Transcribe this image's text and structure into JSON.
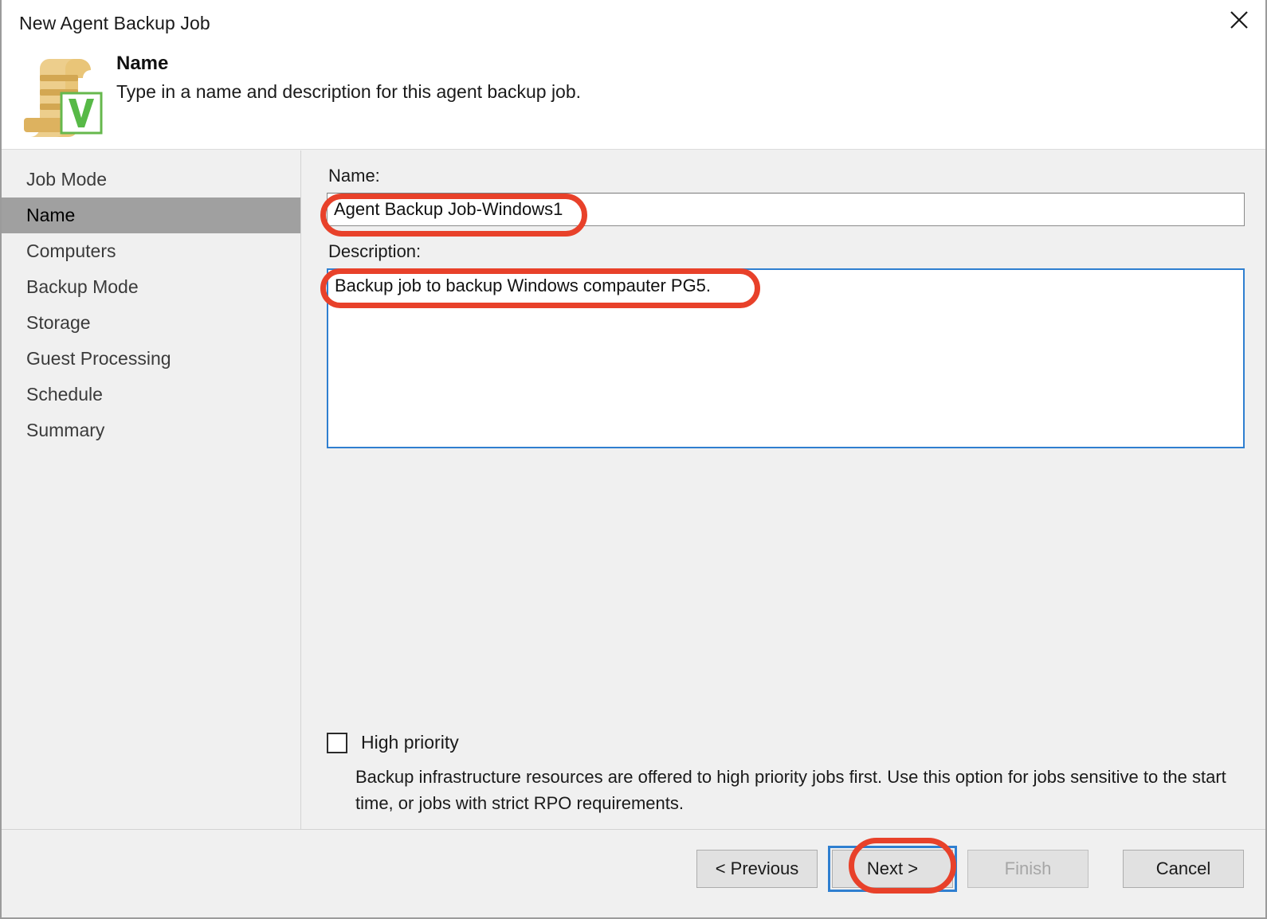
{
  "window": {
    "title": "New Agent Backup Job",
    "close_icon": "close-icon"
  },
  "header": {
    "icon": "document-scroll-veeam-icon",
    "title": "Name",
    "subtitle": "Type in a name and description for this agent backup job."
  },
  "sidebar": {
    "items": [
      {
        "label": "Job Mode",
        "selected": false
      },
      {
        "label": "Name",
        "selected": true
      },
      {
        "label": "Computers",
        "selected": false
      },
      {
        "label": "Backup Mode",
        "selected": false
      },
      {
        "label": "Storage",
        "selected": false
      },
      {
        "label": "Guest Processing",
        "selected": false
      },
      {
        "label": "Schedule",
        "selected": false
      },
      {
        "label": "Summary",
        "selected": false
      }
    ]
  },
  "form": {
    "name_label": "Name:",
    "name_value": "Agent Backup Job-Windows1",
    "name_placeholder": "",
    "description_label": "Description:",
    "description_value": "Backup job to backup Windows compauter PG5.",
    "description_placeholder": "",
    "high_priority_label": "High priority",
    "high_priority_checked": false,
    "high_priority_description": "Backup infrastructure resources are offered to high priority jobs first. Use this option for jobs sensitive to the start time, or jobs with strict RPO requirements."
  },
  "footer": {
    "previous_label": "< Previous",
    "next_label": "Next >",
    "finish_label": "Finish",
    "cancel_label": "Cancel",
    "finish_disabled": true,
    "next_focused": true
  },
  "annotations": {
    "color": "#e8412a",
    "focus_color": "#2f7fd0",
    "targets": [
      "name-input",
      "description-input",
      "next-button"
    ]
  }
}
